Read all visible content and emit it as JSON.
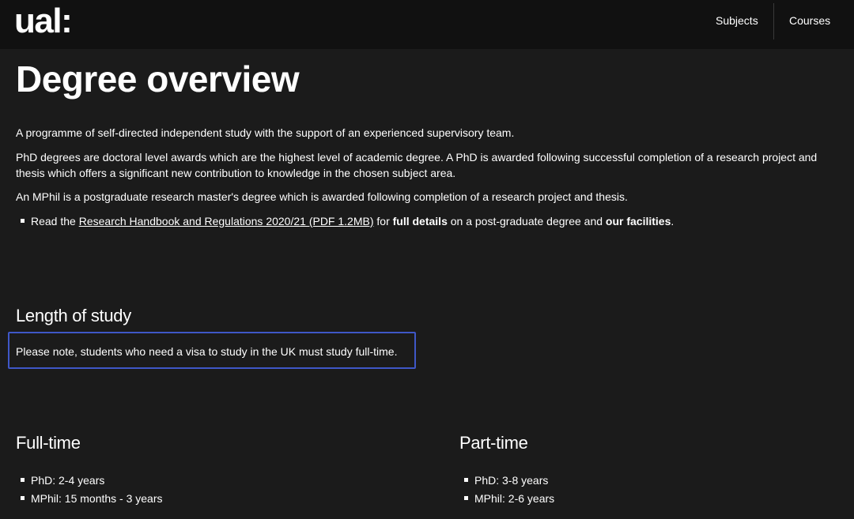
{
  "header": {
    "logo_text": "ual:",
    "nav": {
      "subjects_label": "Subjects",
      "courses_label": "Courses"
    }
  },
  "main": {
    "title": "Degree overview",
    "paragraphs": [
      "A programme of self-directed independent study with the support of an experienced supervisory team.",
      "PhD degrees are doctoral level awards which are the highest level of academic degree. A PhD is awarded following successful completion of a research project and thesis which offers a significant new contribution to knowledge in the chosen subject area.",
      "An MPhil is a postgraduate research master's degree which is awarded following completion of a research project and thesis."
    ],
    "bullet": {
      "prefix": "Read the ",
      "link_text": "Research Handbook and Regulations 2020/21 (PDF 1.2MB)",
      "mid1": " for ",
      "bold1": "full details",
      "mid2": " on a post-graduate degree and ",
      "bold2": "our facilities",
      "suffix": "."
    }
  },
  "length_of_study": {
    "heading": "Length of study",
    "note": "Please note, students who need a visa to study in the UK must study full-time."
  },
  "full_time": {
    "heading": "Full-time",
    "items": [
      "PhD: 2-4 years",
      "MPhil: 15 months - 3 years"
    ]
  },
  "part_time": {
    "heading": "Part-time",
    "items": [
      "PhD: 3-8 years",
      "MPhil: 2-6 years"
    ]
  },
  "colors": {
    "background": "#1b1b1b",
    "header_background": "#111111",
    "focus_outline": "#3f57c7",
    "text": "#ffffff"
  }
}
